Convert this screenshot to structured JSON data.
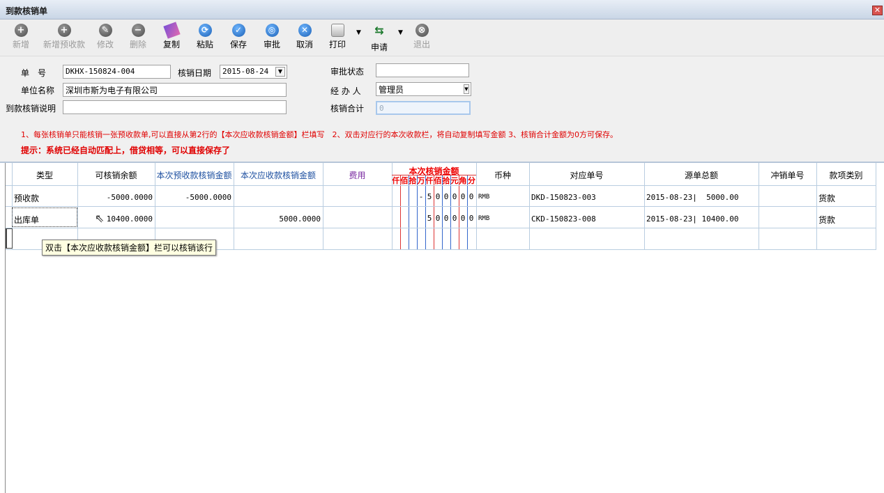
{
  "window": {
    "title": "到款核销单",
    "close_glyph": "✕"
  },
  "toolbar": {
    "items": [
      {
        "label": "新增",
        "icon": "add-icon",
        "enabled": false
      },
      {
        "label": "新增预收款",
        "icon": "add-icon",
        "enabled": false
      },
      {
        "label": "修改",
        "icon": "edit-icon",
        "enabled": false
      },
      {
        "label": "删除",
        "icon": "delete-icon",
        "enabled": false
      },
      {
        "label": "复制",
        "icon": "copy-icon",
        "enabled": true
      },
      {
        "label": "粘贴",
        "icon": "paste-icon",
        "enabled": true
      },
      {
        "label": "保存",
        "icon": "save-icon",
        "enabled": true
      },
      {
        "label": "审批",
        "icon": "approve-icon",
        "enabled": true
      },
      {
        "label": "取消",
        "icon": "cancel-icon",
        "enabled": true
      },
      {
        "label": "打印",
        "icon": "print-icon",
        "enabled": true
      },
      {
        "label": "申请",
        "icon": "apply-icon",
        "enabled": true
      },
      {
        "label": "退出",
        "icon": "exit-icon",
        "enabled": false
      }
    ]
  },
  "form": {
    "doc_no_label": "单　号",
    "doc_no": "DKHX-150824-004",
    "date_label": "核销日期",
    "date": "2015-08-24",
    "approval_label": "审批状态",
    "approval": "",
    "company_label": "单位名称",
    "company": "深圳市斯为电子有限公司",
    "handler_label": "经 办 人",
    "handler": "管理员",
    "remark_label": "到款核销说明",
    "remark": "",
    "total_label": "核销合计",
    "total": "0",
    "note1": "1、每张核销单只能核销一张预收款单,可以直接从第2行的【本次应收款核销金额】栏填写　2、双击对应行的本次收款栏，将自动复制填写金额 3、核销合计金额为0方可保存。",
    "note2": "提示：系统已经自动匹配上，借贷相等，可以直接保存了"
  },
  "grid": {
    "headers": {
      "type": "类型",
      "balance": "可核销余额",
      "prepay": "本次预收款核销金额",
      "receivable": "本次应收款核销金额",
      "fee": "费用",
      "amount_title": "本次核销金额",
      "amount_units": [
        "仟",
        "佰",
        "拾",
        "万",
        "仟",
        "佰",
        "拾",
        "元",
        "角",
        "分"
      ],
      "currency": "币种",
      "ref_no": "对应单号",
      "src_total": "源单总额",
      "offset_no": "冲销单号",
      "category": "款项类别"
    },
    "rows": [
      {
        "type": "预收款",
        "balance": "-5000.0000",
        "prepay": "-5000.0000",
        "receivable": "",
        "fee": "",
        "digits": [
          "",
          "",
          "",
          "-",
          "5",
          "0",
          "0",
          "0",
          "0",
          "0"
        ],
        "currency": "RMB",
        "ref_no": "DKD-150823-003",
        "src_total": "2015-08-23|  5000.00",
        "offset_no": "",
        "category": "货款"
      },
      {
        "type": "出库单",
        "balance": "10400.0000",
        "prepay": "",
        "receivable": "5000.0000",
        "fee": "",
        "digits": [
          "",
          "",
          "",
          "",
          "5",
          "0",
          "0",
          "0",
          "0",
          "0"
        ],
        "currency": "RMB",
        "ref_no": "CKD-150823-008",
        "src_total": "2015-08-23| 10400.00",
        "offset_no": "",
        "category": "货款"
      }
    ],
    "tooltip": "双击【本次应收款核销金额】栏可以核销该行"
  }
}
